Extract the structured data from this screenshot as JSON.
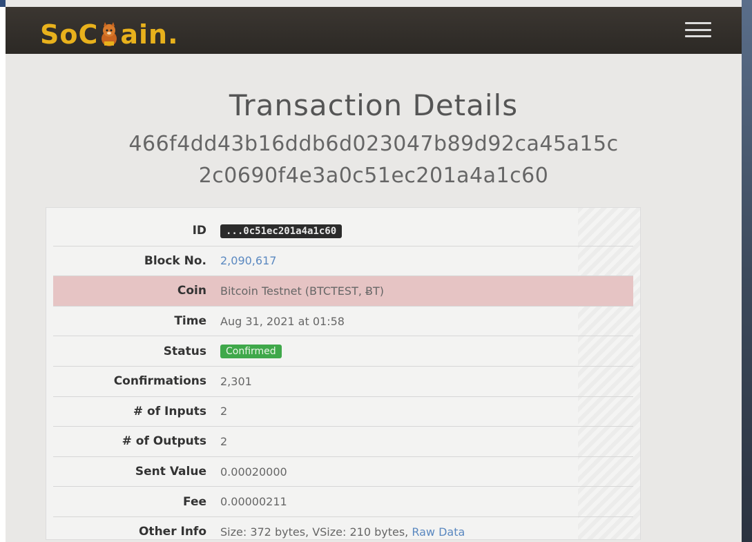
{
  "header": {
    "logo_left": "SoC",
    "logo_right": "ain",
    "logo_dot": ".",
    "menu_icon": "hamburger-icon"
  },
  "page": {
    "title": "Transaction Details",
    "hash_line1": "466f4dd43b16ddb6d023047b89d92ca45a15c",
    "hash_line2": "2c0690f4e3a0c51ec201a4a1c60"
  },
  "details": {
    "id": {
      "label": "ID",
      "value": "...0c51ec201a4a1c60"
    },
    "block": {
      "label": "Block No.",
      "value": "2,090,617"
    },
    "coin": {
      "label": "Coin",
      "value": "Bitcoin Testnet (BTCTEST, ɃT)"
    },
    "time": {
      "label": "Time",
      "value": "Aug 31, 2021 at 01:58"
    },
    "status": {
      "label": "Status",
      "value": "Confirmed"
    },
    "confirmations": {
      "label": "Confirmations",
      "value": "2,301"
    },
    "inputs": {
      "label": "# of Inputs",
      "value": "2"
    },
    "outputs": {
      "label": "# of Outputs",
      "value": "2"
    },
    "sent": {
      "label": "Sent Value",
      "value": "0.00020000"
    },
    "fee": {
      "label": "Fee",
      "value": "0.00000211"
    },
    "other": {
      "label": "Other Info",
      "value": "Size: 372 bytes, VSize: 210 bytes,",
      "raw_link": "Raw Data"
    }
  },
  "colors": {
    "logo": "#e8b11c",
    "navbar": "#2c2925",
    "highlight_row": "#e6c4c4",
    "status_green": "#3fa84a",
    "link": "#5a88c0"
  }
}
